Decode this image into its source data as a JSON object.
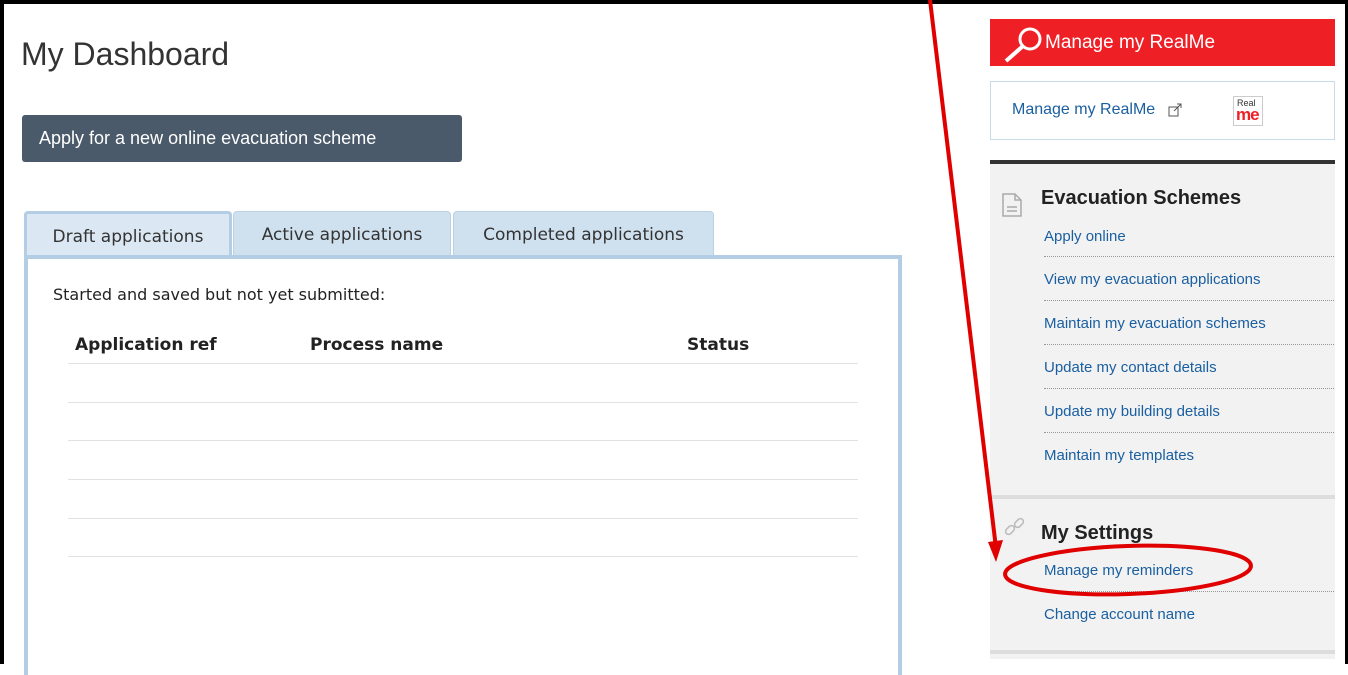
{
  "page": {
    "title": "My Dashboard"
  },
  "actions": {
    "apply_new_label": "Apply for a new online evacuation scheme"
  },
  "tabs": [
    {
      "label": "Draft applications",
      "active": true
    },
    {
      "label": "Active applications",
      "active": false
    },
    {
      "label": "Completed applications",
      "active": false
    }
  ],
  "draft": {
    "intro": "Started and saved but not yet submitted:",
    "columns": [
      "Application ref",
      "Process name",
      "Status"
    ],
    "rows": []
  },
  "sidebar": {
    "realme_button_label": "Manage my RealMe",
    "realme_link_label": "Manage my RealMe",
    "realme_logo_top": "Real",
    "realme_logo_bottom": "me",
    "evacuation": {
      "heading": "Evacuation Schemes",
      "links": [
        "Apply online",
        "View my evacuation applications",
        "Maintain my evacuation schemes",
        "Update my contact details",
        "Update my building details",
        "Maintain my templates"
      ]
    },
    "settings": {
      "heading": "My Settings",
      "links": [
        "Manage my reminders",
        "Change account name"
      ]
    }
  },
  "colors": {
    "realme_red": "#ee2026",
    "apply_button": "#4a5a6a",
    "link_blue": "#1a5fa0",
    "annotation_red": "#e00000"
  },
  "icons": [
    "key-icon",
    "external-link-icon",
    "document-icon",
    "chain-link-icon"
  ]
}
